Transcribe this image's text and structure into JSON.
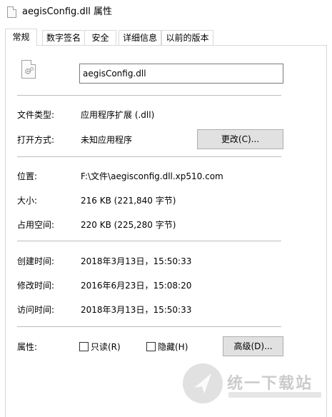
{
  "window": {
    "title": "aegisConfig.dll 属性"
  },
  "tabs": [
    {
      "label": "常规",
      "active": true
    },
    {
      "label": "数字签名",
      "active": false
    },
    {
      "label": "安全",
      "active": false
    },
    {
      "label": "详细信息",
      "active": false
    },
    {
      "label": "以前的版本",
      "active": false
    }
  ],
  "general": {
    "file_icon": "dll-gear-file-icon",
    "file_name": "aegisConfig.dll",
    "file_type_label": "文件类型:",
    "file_type_value": "应用程序扩展 (.dll)",
    "opens_with_label": "打开方式:",
    "opens_with_value": "未知应用程序",
    "change_button": "更改(C)...",
    "location_label": "位置:",
    "location_value": "F:\\文件\\aegisconfig.dll.xp510.com",
    "size_label": "大小:",
    "size_value": "216 KB (221,840 字节)",
    "size_on_disk_label": "占用空间:",
    "size_on_disk_value": "220 KB (225,280 字节)",
    "created_label": "创建时间:",
    "created_value": "2018年3月13日，15:50:33",
    "modified_label": "修改时间:",
    "modified_value": "2016年6月23日，15:08:20",
    "accessed_label": "访问时间:",
    "accessed_value": "2018年3月13日，15:50:33",
    "attributes_label": "属性:",
    "readonly_label": "只读(R)",
    "readonly_checked": false,
    "hidden_label": "隐藏(H)",
    "hidden_checked": false,
    "advanced_button": "高级(D)..."
  },
  "watermark": {
    "text": "统一下载站"
  }
}
